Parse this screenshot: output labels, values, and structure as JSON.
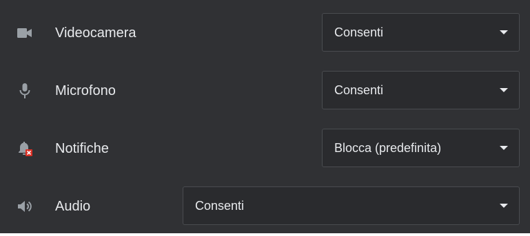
{
  "permissions": [
    {
      "icon": "videocam-icon",
      "label": "Videocamera",
      "value": "Consenti"
    },
    {
      "icon": "microphone-icon",
      "label": "Microfono",
      "value": "Consenti"
    },
    {
      "icon": "notifications-blocked-icon",
      "label": "Notifiche",
      "value": "Blocca (predefinita)"
    },
    {
      "icon": "volume-icon",
      "label": "Audio",
      "value": "Consenti"
    }
  ],
  "colors": {
    "background": "#303134",
    "text": "#e8eaed",
    "icon": "#9aa0a6",
    "blocked_badge": "#d93025"
  }
}
